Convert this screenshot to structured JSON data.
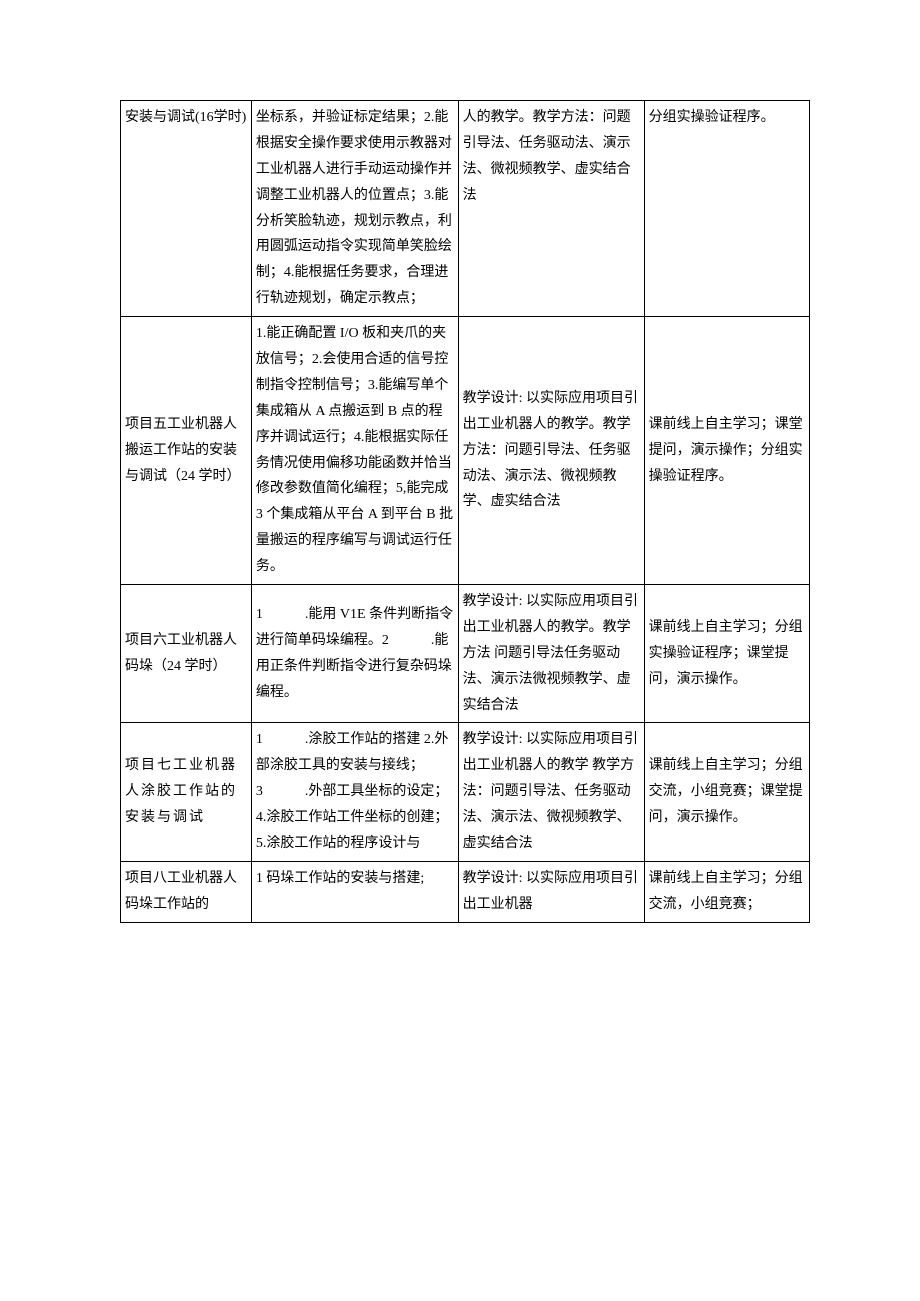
{
  "rows": [
    {
      "c1": "安装与调试(16学时)",
      "c2": "坐标系，并验证标定结果；2.能根据安全操作要求使用示教器对工业机器人进行手动运动操作并调整工业机器人的位置点；3.能分析笑脸轨迹，规划示教点，利用圆弧运动指令实现简单笑脸绘制；4.能根据任务要求，合理进行轨迹规划，确定示教点；",
      "c3": "人的教学。教学方法：问题引导法、任务驱动法、演示法、微视频教学、虚实结合法",
      "c4": "分组实操验证程序。"
    },
    {
      "c1": "项目五工业机器人搬运工作站的安装与调试（24 学时）",
      "c2": "1.能正确配置 I/O 板和夹爪的夹放信号；2.会使用合适的信号控制指令控制信号；3.能编写单个集成箱从 A 点搬运到 B 点的程序并调试运行；4.能根据实际任务情况使用偏移功能函数并恰当修改参数值简化编程；5,能完成 3 个集成箱从平台 A 到平台 B 批量搬运的程序编写与调试运行任务。",
      "c3": "教学设计: 以实际应用项目引出工业机器人的教学。教学方法：问题引导法、任务驱动法、演示法、微视频教学、虚实结合法",
      "c4": "课前线上自主学习；课堂提问，演示操作；分组实操验证程序。"
    },
    {
      "c1": "项目六工业机器人码垛（24 学时）",
      "c2": "1　　　.能用 V1E 条件判断指令进行简单码垛编程。2　　　.能用正条件判断指令进行复杂码垛编程。",
      "c3": "教学设计: 以实际应用项目引出工业机器人的教学。教学方法 问题引导法任务驱动法、演示法微视频教学、虚实结合法",
      "c4": "课前线上自主学习；分组实操验证程序；课堂提问，演示操作。"
    },
    {
      "c1": "项目七工业机器人涂胶工作站的安装与调试",
      "c2": "1　　　.涂胶工作站的搭建 2.外部涂胶工具的安装与接线；3　　　.外部工具坐标的设定；4.涂胶工作站工件坐标的创建；5.涂胶工作站的程序设计与",
      "c3": "教学设计: 以实际应用项目引出工业机器人的教学 教学方法：问题引导法、任务驱动法、演示法、微视频教学、虚实结合法",
      "c4": "课前线上自主学习；分组交流，小组竞赛；课堂提问，演示操作。"
    },
    {
      "c1": "项目八工业机器人码垛工作站的",
      "c2": "1 码垛工作站的安装与搭建;",
      "c3": "教学设计: 以实际应用项目引出工业机器",
      "c4": "课前线上自主学习；分组交流，小组竞赛；"
    }
  ]
}
